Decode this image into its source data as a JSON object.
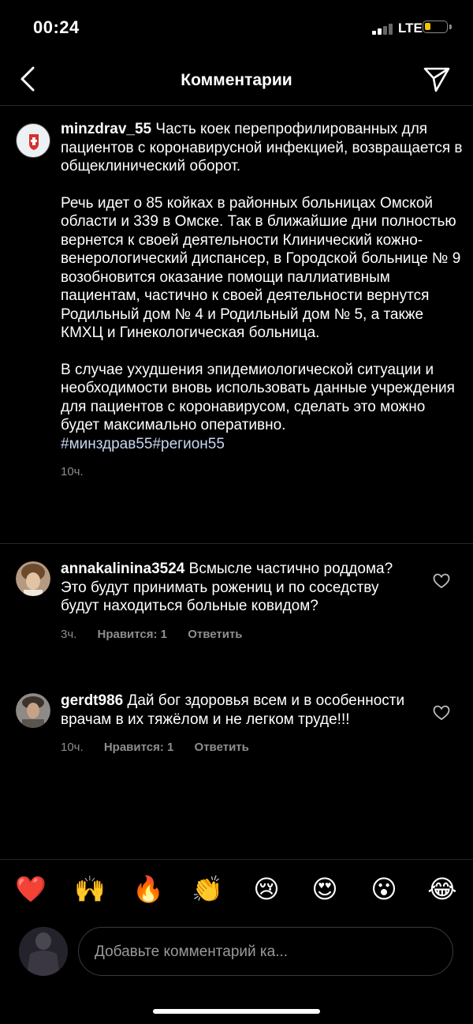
{
  "status": {
    "time": "00:24",
    "network": "LTE"
  },
  "header": {
    "title": "Комментарии"
  },
  "post": {
    "username": "minzdrav_55",
    "paragraphs": [
      "Часть коек перепрофилированных для пациентов с коронавирусной инфекцией, возвращается в общеклинический оборот.",
      "Речь идет о 85 койках в районных больницах Омской области и 339 в Омске. Так в ближайшие дни полностью вернется к своей деятельности Клинический кожно-венерологический диспансер, в Городской больнице № 9 возобновится оказание помощи паллиативным пациентам, частично к своей деятельности вернутся Родильный дом № 4 и Родильный дом № 5, а также КМХЦ и Гинекологическая больница.",
      "В случае ухудшения эпидемиологической ситуации и необходимости вновь использовать данные учреждения для пациентов с коронавирусом, сделать это можно будет максимально оперативно."
    ],
    "hashtags": "#минздрав55#регион55",
    "time": "10ч."
  },
  "comments": [
    {
      "username": "annakalinina3524",
      "text": "Всмысле частично роддома? Это будут принимать рожениц и по соседству будут находиться больные ковидом?",
      "time": "3ч.",
      "likes": "Нравится: 1",
      "reply": "Ответить"
    },
    {
      "username": "gerdt986",
      "text": "Дай бог здоровья всем и в особенности врачам в их тяжёлом и не легком труде!!!",
      "time": "10ч.",
      "likes": "Нравится: 1",
      "reply": "Ответить"
    }
  ],
  "emojis": [
    "❤️",
    "🙌",
    "🔥",
    "👏",
    "😢",
    "😍",
    "😮",
    "😂"
  ],
  "input": {
    "placeholder": "Добавьте комментарий ка..."
  },
  "colors": {
    "background": "#000000",
    "hashtag": "#c7d7f0",
    "battery": "#f5c400",
    "muted": "#8e8e8e"
  }
}
